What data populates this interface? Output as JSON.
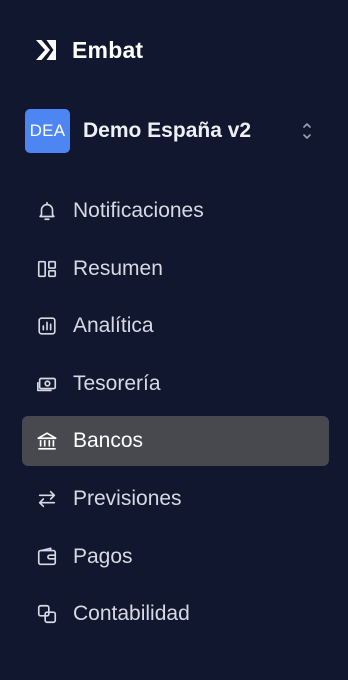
{
  "brand": {
    "name": "Embat",
    "icon": "embat-logo-icon"
  },
  "org": {
    "initials": "DEA",
    "name": "Demo España v2",
    "icon": "chevron-up-down-icon",
    "avatar_color": "#4d86f3"
  },
  "nav": {
    "items": [
      {
        "label": "Notificaciones",
        "icon": "bell-icon"
      },
      {
        "label": "Resumen",
        "icon": "dashboard-icon"
      },
      {
        "label": "Analítica",
        "icon": "chart-icon"
      },
      {
        "label": "Tesorería",
        "icon": "cash-icon"
      },
      {
        "label": "Bancos",
        "icon": "bank-icon",
        "active": true
      },
      {
        "label": "Previsiones",
        "icon": "arrows-left-right-icon"
      },
      {
        "label": "Pagos",
        "icon": "wallet-icon"
      },
      {
        "label": "Contabilidad",
        "icon": "linked-squares-icon"
      }
    ]
  },
  "colors": {
    "background": "#10172e",
    "active_item": "#47494f",
    "text": "#d7dae3"
  }
}
